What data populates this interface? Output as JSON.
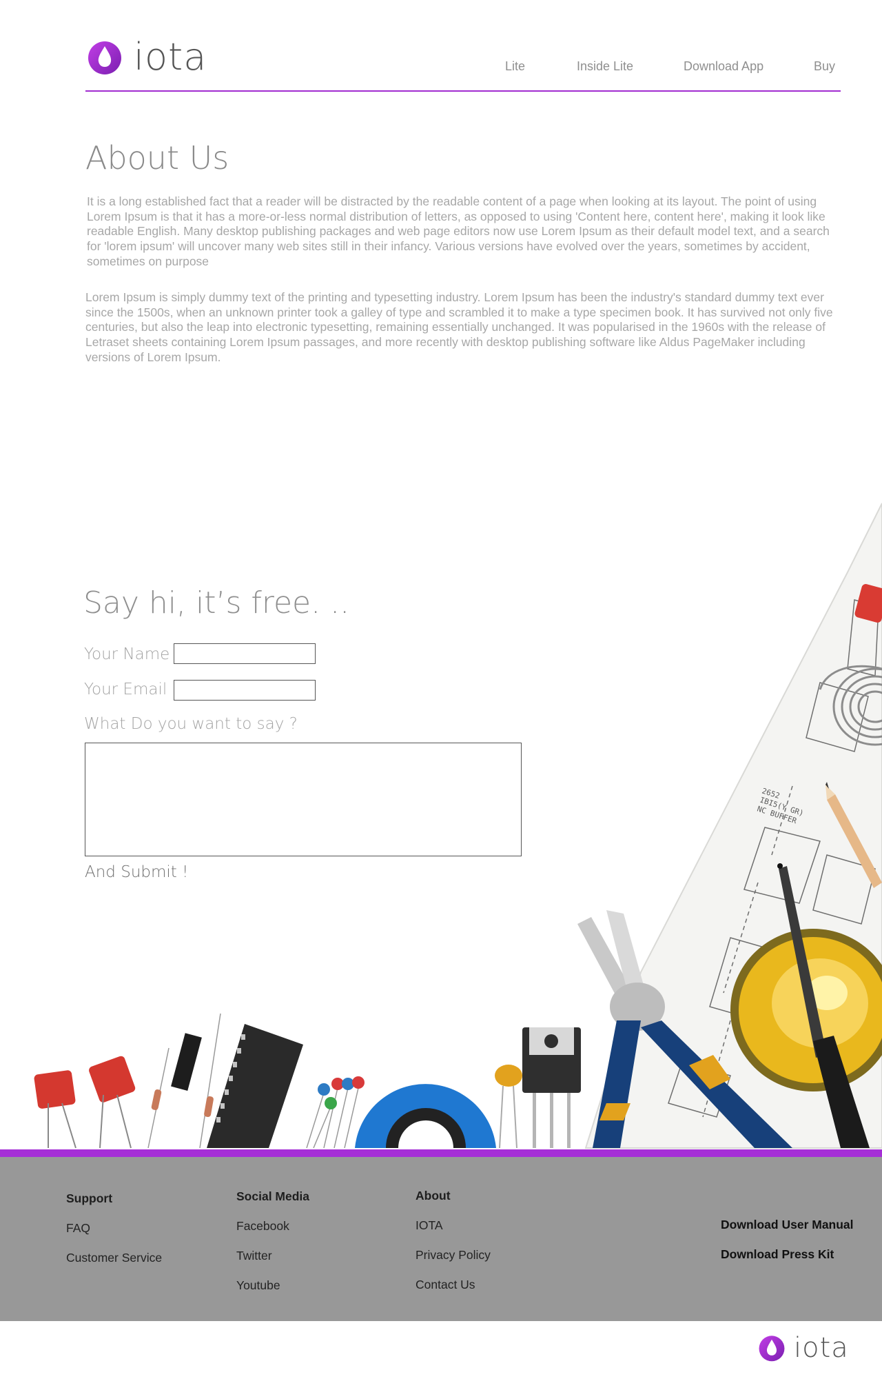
{
  "brand": {
    "name": "iota",
    "accent": "#a12cd0",
    "footer_bg": "#989898"
  },
  "nav": {
    "items": [
      "Lite",
      "Inside Lite",
      "Download App",
      "Buy"
    ]
  },
  "about": {
    "title": "About Us",
    "paragraph1": "It is a long established fact that a reader will be distracted by the readable content of a page when looking at its layout. The point of using Lorem Ipsum is that it has a more-or-less normal distribution of letters, as opposed to using 'Content here, content here', making it look like readable English. Many desktop publishing packages and web page editors now use Lorem Ipsum as their default model text, and a search for 'lorem ipsum' will uncover many web sites still in their infancy. Various versions have evolved over the years, sometimes by accident, sometimes on purpose",
    "paragraph2": "Lorem Ipsum is simply dummy text of the printing and typesetting industry. Lorem Ipsum has been the industry's standard dummy text ever since the 1500s, when an unknown printer took a galley of type and scrambled it to make a type specimen book. It has survived not only five centuries, but also the leap into electronic typesetting, remaining essentially unchanged. It was popularised in the 1960s with the release of Letraset sheets containing Lorem Ipsum passages, and more recently with desktop publishing software like Aldus PageMaker including versions of Lorem Ipsum."
  },
  "contact": {
    "title": "Say hi, it’s free. ..",
    "name_label": "Your Name",
    "name_value": "",
    "email_label": "Your Email",
    "email_value": "",
    "message_label": "What Do you want to say ?",
    "message_value": "",
    "submit_label": "And Submit !"
  },
  "footer": {
    "support": {
      "heading": "Support",
      "links": [
        "FAQ",
        "Customer Service"
      ]
    },
    "social": {
      "heading": "Social Media",
      "links": [
        "Facebook",
        "Twitter",
        "Youtube"
      ]
    },
    "about": {
      "heading": "About",
      "links": [
        "IOTA",
        "Privacy Policy",
        "Contact Us"
      ]
    },
    "downloads": [
      "Download User Manual",
      "Download Press Kit"
    ]
  },
  "illustration": {
    "icon": "electronics-tools-illustration"
  }
}
